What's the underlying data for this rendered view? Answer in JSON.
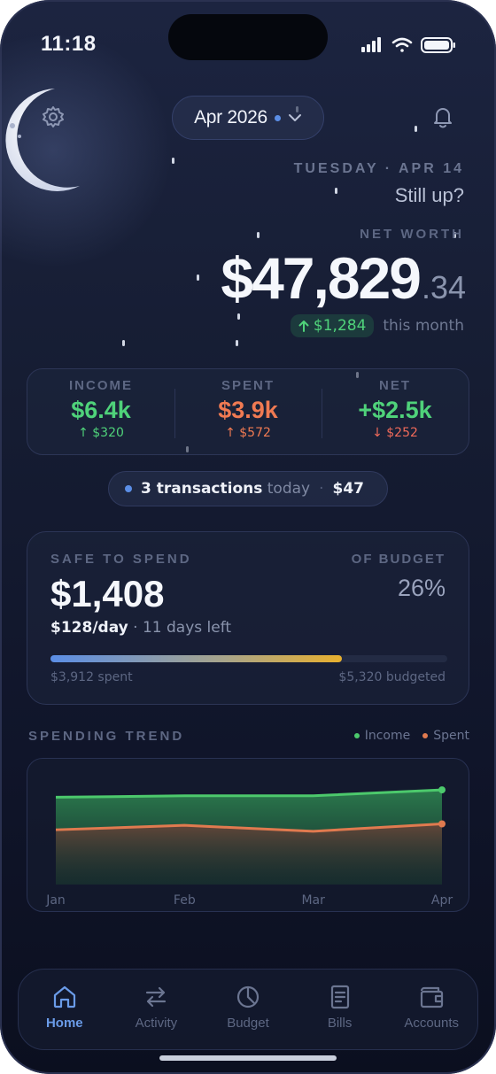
{
  "status_bar": {
    "time": "11:18"
  },
  "header": {
    "month_label": "Apr 2026",
    "settings_icon": "gear-icon",
    "notifications_icon": "bell-icon"
  },
  "greeting": {
    "date_line": "TUESDAY · APR 14",
    "message": "Still up?"
  },
  "net_worth": {
    "label": "NET WORTH",
    "value_main": "$47,829",
    "value_cents": ".34",
    "change": "$1,284",
    "change_suffix": "this month"
  },
  "summary": {
    "income": {
      "label": "INCOME",
      "value": "$6.4k",
      "delta": "↑ $320"
    },
    "spent": {
      "label": "SPENT",
      "value": "$3.9k",
      "delta": "↑ $572"
    },
    "net": {
      "label": "NET",
      "value": "+$2.5k",
      "delta": "↓ $252"
    }
  },
  "transactions": {
    "count_text": "3 transactions",
    "today_text": "today",
    "separator": "·",
    "amount": "$47"
  },
  "safe_to_spend": {
    "label": "SAFE TO SPEND",
    "value": "$1,408",
    "per_day": "$128/day",
    "days_left": "· 11 days left",
    "of_budget_label": "OF BUDGET",
    "of_budget_value": "26%",
    "progress_fraction": 0.735,
    "spent_text": "$3,912 spent",
    "budgeted_text": "$5,320 budgeted"
  },
  "trend": {
    "title": "SPENDING TREND",
    "legend_income": "Income",
    "legend_spent": "Spent"
  },
  "chart_data": {
    "type": "area",
    "categories": [
      "Jan",
      "Feb",
      "Mar",
      "Apr"
    ],
    "series": [
      {
        "name": "Income",
        "values": [
          5.9,
          6.0,
          6.0,
          6.4
        ]
      },
      {
        "name": "Spent",
        "values": [
          3.7,
          4.0,
          3.6,
          4.1
        ]
      }
    ],
    "ylim": [
      0,
      8.5
    ],
    "colors": {
      "Income": "#4cc96c",
      "Spent": "#e07a4f"
    },
    "grid": false,
    "legend": "top-right"
  },
  "tabs": [
    {
      "label": "Home",
      "icon": "home-icon",
      "active": true
    },
    {
      "label": "Activity",
      "icon": "swap-arrows-icon",
      "active": false
    },
    {
      "label": "Budget",
      "icon": "pie-clock-icon",
      "active": false
    },
    {
      "label": "Bills",
      "icon": "receipt-icon",
      "active": false
    },
    {
      "label": "Accounts",
      "icon": "wallet-icon",
      "active": false
    }
  ],
  "colors": {
    "accent": "#6a9be8",
    "income": "#4fd27a",
    "spent": "#f07a52",
    "net_positive": "#4fd27a",
    "net_delta": "#ef6a5a"
  }
}
